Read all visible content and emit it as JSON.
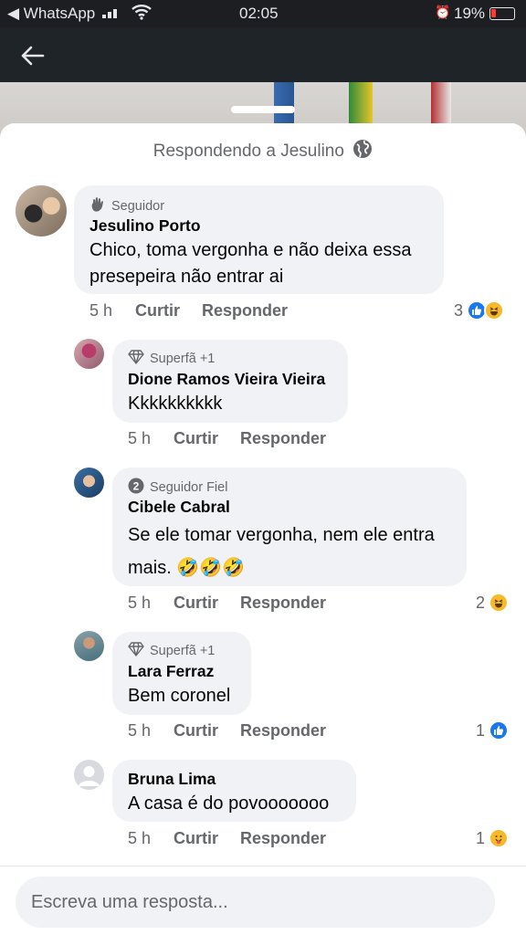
{
  "status_bar": {
    "back_app": "◀ WhatsApp",
    "time": "02:05",
    "battery": "19%"
  },
  "colors": {
    "like_blue": "#1877f2",
    "haha_yellow": "#f7b928",
    "sheet_bubble": "#f0f2f5",
    "secondary_text": "#65676b"
  },
  "reply_header": {
    "label": "Respondendo a Jesulino",
    "icon": "globe-icon"
  },
  "comments": [
    {
      "badge": "Seguidor",
      "badge_icon": "wave-icon",
      "author": "Jesulino Porto",
      "text": "Chico, toma vergonha e não deixa essa presepeira não entrar ai",
      "time": "5 h",
      "like": "Curtir",
      "reply": "Responder",
      "reaction_count": "3",
      "reactions": [
        "like",
        "haha"
      ]
    },
    {
      "badge": "Superfã +1",
      "badge_icon": "diamond-icon",
      "author": "Dione Ramos Vieira Vieira",
      "text": "Kkkkkkkkkk",
      "time": "5 h",
      "like": "Curtir",
      "reply": "Responder",
      "reaction_count": "",
      "reactions": []
    },
    {
      "badge": "Seguidor Fiel",
      "badge_icon": "level-2-icon",
      "author": "Cibele Cabral",
      "text": "Se ele tomar vergonha, nem ele entra mais. 🤣🤣🤣",
      "time": "5 h",
      "like": "Curtir",
      "reply": "Responder",
      "reaction_count": "2",
      "reactions": [
        "haha"
      ]
    },
    {
      "badge": "Superfã +1",
      "badge_icon": "diamond-icon",
      "author": "Lara Ferraz",
      "text": "Bem coronel",
      "time": "5 h",
      "like": "Curtir",
      "reply": "Responder",
      "reaction_count": "1",
      "reactions": [
        "like"
      ]
    },
    {
      "badge": "",
      "badge_icon": "",
      "author": "Bruna Lima",
      "text": "A casa é do povooooooo",
      "time": "5 h",
      "like": "Curtir",
      "reply": "Responder",
      "reaction_count": "1",
      "reactions": [
        "care"
      ]
    }
  ],
  "composer": {
    "placeholder": "Escreva uma resposta..."
  }
}
